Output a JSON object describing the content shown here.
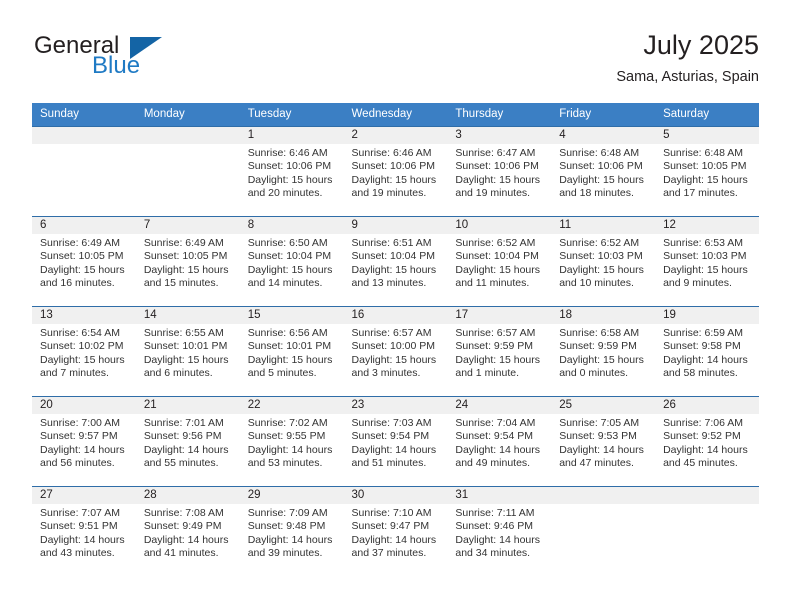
{
  "brand": {
    "name_part1": "General",
    "name_part2": "Blue",
    "logo_icon": "blue-triangle-flag"
  },
  "header": {
    "month_title": "July 2025",
    "location": "Sama, Asturias, Spain"
  },
  "colors": {
    "header_blue": "#3b7fc4",
    "grid_blue": "#2f6da8",
    "brand_blue": "#1f7ac4",
    "daynum_band": "#f0f0f0",
    "text": "#231f20"
  },
  "calendar": {
    "weekday_headers": [
      "Sunday",
      "Monday",
      "Tuesday",
      "Wednesday",
      "Thursday",
      "Friday",
      "Saturday"
    ],
    "weeks": [
      [
        {
          "day": "",
          "lines": []
        },
        {
          "day": "",
          "lines": []
        },
        {
          "day": "1",
          "lines": [
            "Sunrise: 6:46 AM",
            "Sunset: 10:06 PM",
            "Daylight: 15 hours",
            "and 20 minutes."
          ]
        },
        {
          "day": "2",
          "lines": [
            "Sunrise: 6:46 AM",
            "Sunset: 10:06 PM",
            "Daylight: 15 hours",
            "and 19 minutes."
          ]
        },
        {
          "day": "3",
          "lines": [
            "Sunrise: 6:47 AM",
            "Sunset: 10:06 PM",
            "Daylight: 15 hours",
            "and 19 minutes."
          ]
        },
        {
          "day": "4",
          "lines": [
            "Sunrise: 6:48 AM",
            "Sunset: 10:06 PM",
            "Daylight: 15 hours",
            "and 18 minutes."
          ]
        },
        {
          "day": "5",
          "lines": [
            "Sunrise: 6:48 AM",
            "Sunset: 10:05 PM",
            "Daylight: 15 hours",
            "and 17 minutes."
          ]
        }
      ],
      [
        {
          "day": "6",
          "lines": [
            "Sunrise: 6:49 AM",
            "Sunset: 10:05 PM",
            "Daylight: 15 hours",
            "and 16 minutes."
          ]
        },
        {
          "day": "7",
          "lines": [
            "Sunrise: 6:49 AM",
            "Sunset: 10:05 PM",
            "Daylight: 15 hours",
            "and 15 minutes."
          ]
        },
        {
          "day": "8",
          "lines": [
            "Sunrise: 6:50 AM",
            "Sunset: 10:04 PM",
            "Daylight: 15 hours",
            "and 14 minutes."
          ]
        },
        {
          "day": "9",
          "lines": [
            "Sunrise: 6:51 AM",
            "Sunset: 10:04 PM",
            "Daylight: 15 hours",
            "and 13 minutes."
          ]
        },
        {
          "day": "10",
          "lines": [
            "Sunrise: 6:52 AM",
            "Sunset: 10:04 PM",
            "Daylight: 15 hours",
            "and 11 minutes."
          ]
        },
        {
          "day": "11",
          "lines": [
            "Sunrise: 6:52 AM",
            "Sunset: 10:03 PM",
            "Daylight: 15 hours",
            "and 10 minutes."
          ]
        },
        {
          "day": "12",
          "lines": [
            "Sunrise: 6:53 AM",
            "Sunset: 10:03 PM",
            "Daylight: 15 hours",
            "and 9 minutes."
          ]
        }
      ],
      [
        {
          "day": "13",
          "lines": [
            "Sunrise: 6:54 AM",
            "Sunset: 10:02 PM",
            "Daylight: 15 hours",
            "and 7 minutes."
          ]
        },
        {
          "day": "14",
          "lines": [
            "Sunrise: 6:55 AM",
            "Sunset: 10:01 PM",
            "Daylight: 15 hours",
            "and 6 minutes."
          ]
        },
        {
          "day": "15",
          "lines": [
            "Sunrise: 6:56 AM",
            "Sunset: 10:01 PM",
            "Daylight: 15 hours",
            "and 5 minutes."
          ]
        },
        {
          "day": "16",
          "lines": [
            "Sunrise: 6:57 AM",
            "Sunset: 10:00 PM",
            "Daylight: 15 hours",
            "and 3 minutes."
          ]
        },
        {
          "day": "17",
          "lines": [
            "Sunrise: 6:57 AM",
            "Sunset: 9:59 PM",
            "Daylight: 15 hours",
            "and 1 minute."
          ]
        },
        {
          "day": "18",
          "lines": [
            "Sunrise: 6:58 AM",
            "Sunset: 9:59 PM",
            "Daylight: 15 hours",
            "and 0 minutes."
          ]
        },
        {
          "day": "19",
          "lines": [
            "Sunrise: 6:59 AM",
            "Sunset: 9:58 PM",
            "Daylight: 14 hours",
            "and 58 minutes."
          ]
        }
      ],
      [
        {
          "day": "20",
          "lines": [
            "Sunrise: 7:00 AM",
            "Sunset: 9:57 PM",
            "Daylight: 14 hours",
            "and 56 minutes."
          ]
        },
        {
          "day": "21",
          "lines": [
            "Sunrise: 7:01 AM",
            "Sunset: 9:56 PM",
            "Daylight: 14 hours",
            "and 55 minutes."
          ]
        },
        {
          "day": "22",
          "lines": [
            "Sunrise: 7:02 AM",
            "Sunset: 9:55 PM",
            "Daylight: 14 hours",
            "and 53 minutes."
          ]
        },
        {
          "day": "23",
          "lines": [
            "Sunrise: 7:03 AM",
            "Sunset: 9:54 PM",
            "Daylight: 14 hours",
            "and 51 minutes."
          ]
        },
        {
          "day": "24",
          "lines": [
            "Sunrise: 7:04 AM",
            "Sunset: 9:54 PM",
            "Daylight: 14 hours",
            "and 49 minutes."
          ]
        },
        {
          "day": "25",
          "lines": [
            "Sunrise: 7:05 AM",
            "Sunset: 9:53 PM",
            "Daylight: 14 hours",
            "and 47 minutes."
          ]
        },
        {
          "day": "26",
          "lines": [
            "Sunrise: 7:06 AM",
            "Sunset: 9:52 PM",
            "Daylight: 14 hours",
            "and 45 minutes."
          ]
        }
      ],
      [
        {
          "day": "27",
          "lines": [
            "Sunrise: 7:07 AM",
            "Sunset: 9:51 PM",
            "Daylight: 14 hours",
            "and 43 minutes."
          ]
        },
        {
          "day": "28",
          "lines": [
            "Sunrise: 7:08 AM",
            "Sunset: 9:49 PM",
            "Daylight: 14 hours",
            "and 41 minutes."
          ]
        },
        {
          "day": "29",
          "lines": [
            "Sunrise: 7:09 AM",
            "Sunset: 9:48 PM",
            "Daylight: 14 hours",
            "and 39 minutes."
          ]
        },
        {
          "day": "30",
          "lines": [
            "Sunrise: 7:10 AM",
            "Sunset: 9:47 PM",
            "Daylight: 14 hours",
            "and 37 minutes."
          ]
        },
        {
          "day": "31",
          "lines": [
            "Sunrise: 7:11 AM",
            "Sunset: 9:46 PM",
            "Daylight: 14 hours",
            "and 34 minutes."
          ]
        },
        {
          "day": "",
          "lines": []
        },
        {
          "day": "",
          "lines": []
        }
      ]
    ]
  }
}
